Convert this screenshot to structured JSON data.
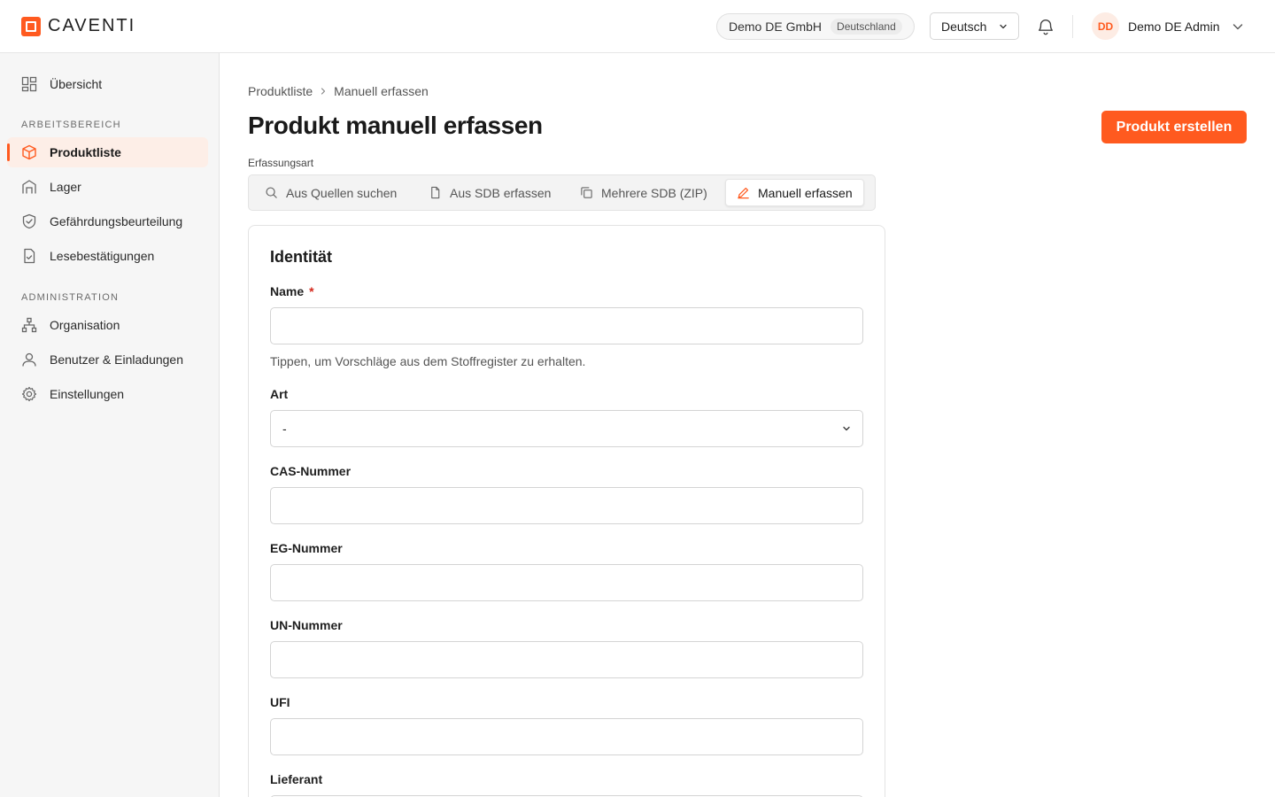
{
  "brand": {
    "name": "CAVENTI",
    "accent": "#ff5a1f"
  },
  "header": {
    "org_name": "Demo DE GmbH",
    "org_country": "Deutschland",
    "language": "Deutsch",
    "user_initials": "DD",
    "user_name": "Demo DE Admin"
  },
  "sidebar": {
    "overview": "Übersicht",
    "section_workspace": "ARBEITSBEREICH",
    "workspace_items": [
      "Produktliste",
      "Lager",
      "Gefährdungsbeurteilung",
      "Lesebestätigungen"
    ],
    "section_admin": "ADMINISTRATION",
    "admin_items": [
      "Organisation",
      "Benutzer & Einladungen",
      "Einstellungen"
    ],
    "active_item": "Produktliste"
  },
  "breadcrumb": {
    "parent": "Produktliste",
    "current": "Manuell erfassen"
  },
  "page": {
    "title": "Produkt manuell erfassen",
    "create_button": "Produkt erstellen"
  },
  "capture_mode": {
    "label": "Erfassungsart",
    "tabs": [
      "Aus Quellen suchen",
      "Aus SDB erfassen",
      "Mehrere SDB (ZIP)",
      "Manuell erfassen"
    ],
    "active": "Manuell erfassen"
  },
  "form": {
    "section_title": "Identität",
    "name_label": "Name",
    "name_required": "*",
    "name_value": "",
    "name_hint": "Tippen, um Vorschläge aus dem Stoffregister zu erhalten.",
    "type_label": "Art",
    "type_value": "-",
    "cas_label": "CAS-Nummer",
    "cas_value": "",
    "eg_label": "EG-Nummer",
    "eg_value": "",
    "un_label": "UN-Nummer",
    "un_value": "",
    "ufi_label": "UFI",
    "ufi_value": "",
    "supplier_label": "Lieferant",
    "supplier_value": ""
  }
}
